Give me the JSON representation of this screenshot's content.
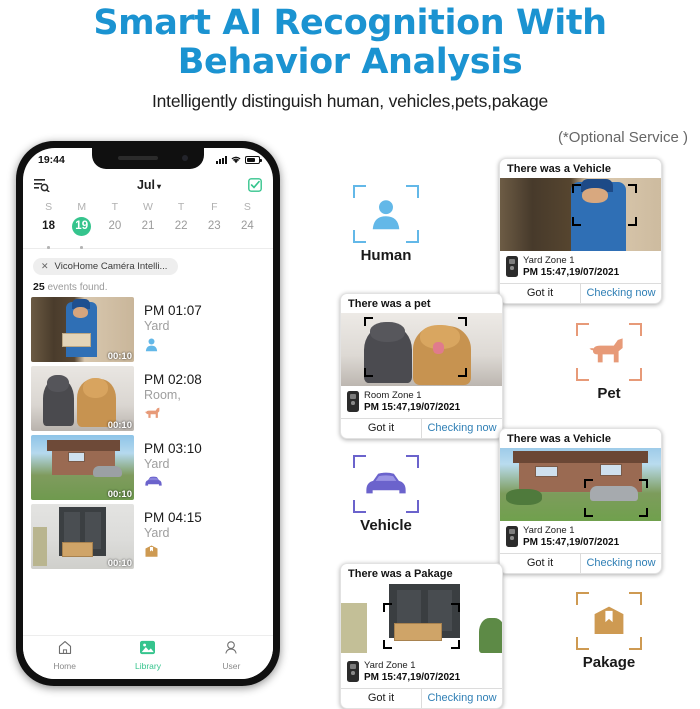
{
  "hero": {
    "title_line1": "Smart AI Recognition With",
    "title_line2": "Behavior Analysis",
    "subtitle": "Intelligently distinguish human, vehicles,pets,pakage",
    "optional_note": "(*Optional Service )",
    "accent_blue": "#1b93d1"
  },
  "phone": {
    "status": {
      "time": "19:44",
      "signal_icon": "signal-bars-icon",
      "wifi_icon": "wifi-icon",
      "battery_icon": "battery-icon"
    },
    "appbar": {
      "search_icon": "search-list-icon",
      "month": "Jul",
      "caret": "▾",
      "select_icon": "checkbox-check-icon"
    },
    "calendar": {
      "dow": [
        "S",
        "M",
        "T",
        "W",
        "T",
        "F",
        "S"
      ],
      "days": [
        "18",
        "19",
        "20",
        "21",
        "22",
        "23",
        "24"
      ],
      "selected_index": 1,
      "bold_index": 0,
      "dot_indexes": [
        0,
        1
      ],
      "selected_color": "#35c48d"
    },
    "filter_chip": {
      "close_icon": "close-icon",
      "label": "VicoHome Caméra Intelli..."
    },
    "result_count": "25",
    "result_text": "events found.",
    "events": [
      {
        "time": "PM 01:07",
        "zone": "Yard",
        "duration": "00:10",
        "type_icon": "human-icon",
        "scene": "delivery-man-at-door"
      },
      {
        "time": "PM 02:08",
        "zone": "Room,",
        "duration": "00:10",
        "type_icon": "pet-icon",
        "scene": "cat-and-dog"
      },
      {
        "time": "PM 03:10",
        "zone": "Yard",
        "duration": "00:10",
        "type_icon": "vehicle-icon",
        "scene": "house-with-car"
      },
      {
        "time": "PM 04:15",
        "zone": "Yard",
        "duration": "00:10",
        "type_icon": "package-icon",
        "scene": "package-at-door"
      }
    ],
    "tabs": [
      {
        "label": "Home",
        "icon": "home-icon",
        "active": false
      },
      {
        "label": "Library",
        "icon": "library-icon",
        "active": true
      },
      {
        "label": "User",
        "icon": "user-icon",
        "active": false
      }
    ]
  },
  "categories": [
    {
      "name": "Human",
      "icon": "human-icon",
      "color": "#63b8e8"
    },
    {
      "name": "Pet",
      "icon": "pet-icon",
      "color": "#e79a78"
    },
    {
      "name": "Vehicle",
      "icon": "vehicle-icon",
      "color": "#6b63cc"
    },
    {
      "name": "Pakage",
      "icon": "package-icon",
      "color": "#ce9a52"
    }
  ],
  "cards": [
    {
      "title": "There was a Vehicle",
      "zone": "Yard Zone 1",
      "datetime": "PM 15:47,19/07/2021",
      "action_secondary": "Got it",
      "action_primary": "Checking now",
      "scene": "delivery-man-at-door",
      "device_icon": "remote-camera-icon"
    },
    {
      "title": "There was a pet",
      "zone": "Room Zone 1",
      "datetime": "PM 15:47,19/07/2021",
      "action_secondary": "Got it",
      "action_primary": "Checking now",
      "scene": "cat-and-dog",
      "device_icon": "remote-camera-icon"
    },
    {
      "title": "There was a Vehicle",
      "zone": "Yard Zone 1",
      "datetime": "PM 15:47,19/07/2021",
      "action_secondary": "Got it",
      "action_primary": "Checking now",
      "scene": "house-with-car",
      "device_icon": "remote-camera-icon"
    },
    {
      "title": "There was a Pakage",
      "zone": "Yard Zone 1",
      "datetime": "PM 15:47,19/07/2021",
      "action_secondary": "Got it",
      "action_primary": "Checking now",
      "scene": "package-at-door",
      "device_icon": "remote-camera-icon"
    }
  ]
}
